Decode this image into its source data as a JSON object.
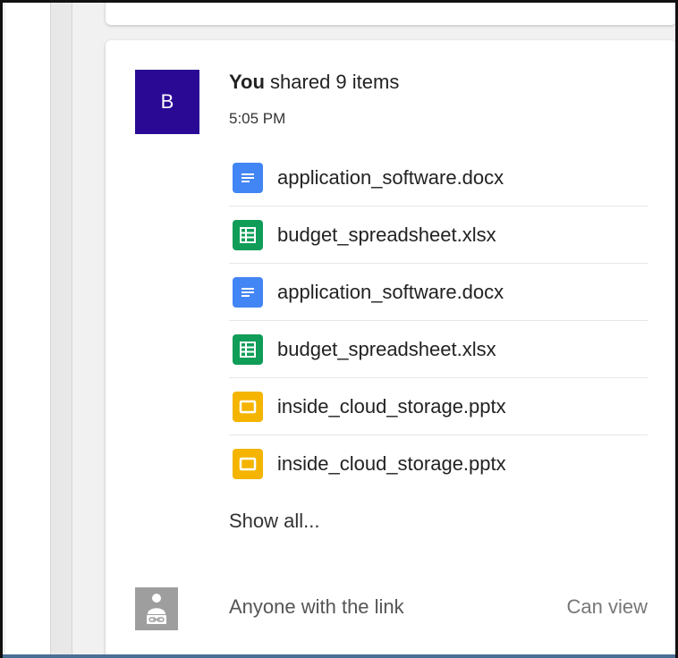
{
  "activity": {
    "avatar_letter": "B",
    "avatar_color": "#2a0a95",
    "actor": "You",
    "action": " shared 9 items",
    "time": "5:05 PM",
    "files": [
      {
        "name": "application_software.docx",
        "icon": "docs-icon",
        "color": "#4285f4"
      },
      {
        "name": "budget_spreadsheet.xlsx",
        "icon": "sheets-icon",
        "color": "#0f9d58"
      },
      {
        "name": "application_software.docx",
        "icon": "docs-icon",
        "color": "#4285f4"
      },
      {
        "name": "budget_spreadsheet.xlsx",
        "icon": "sheets-icon",
        "color": "#0f9d58"
      },
      {
        "name": "inside_cloud_storage.pptx",
        "icon": "slides-icon",
        "color": "#f4b400"
      },
      {
        "name": "inside_cloud_storage.pptx",
        "icon": "slides-icon",
        "color": "#f4b400"
      }
    ],
    "show_all_label": "Show all...",
    "share": {
      "icon": "link-sharing-icon",
      "text": "Anyone with the link",
      "permission": "Can view"
    }
  }
}
